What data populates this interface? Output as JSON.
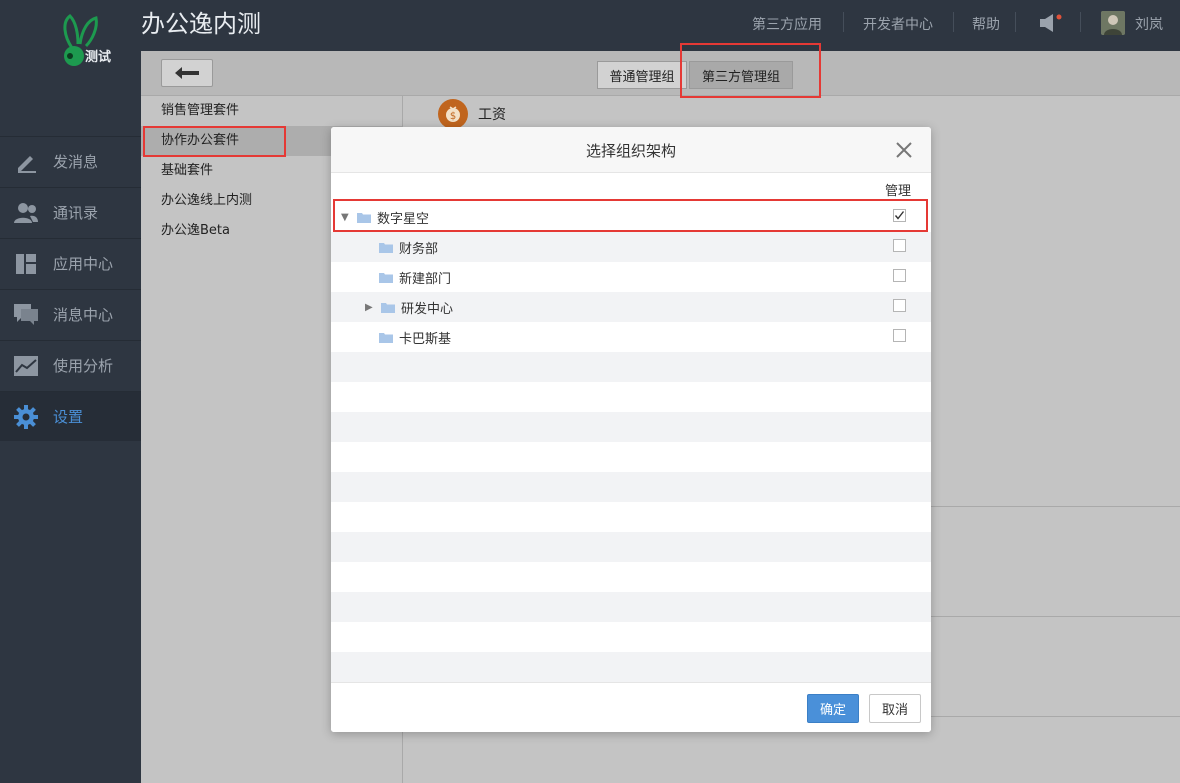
{
  "app": {
    "title": "办公逸内测",
    "logo_text": "测试"
  },
  "header": {
    "links": [
      "第三方应用",
      "开发者中心",
      "帮助"
    ],
    "user_name": "刘岚"
  },
  "sidebar": {
    "items": [
      {
        "label": "发消息",
        "icon": "pencil-icon"
      },
      {
        "label": "通讯录",
        "icon": "contacts-icon"
      },
      {
        "label": "应用中心",
        "icon": "apps-icon"
      },
      {
        "label": "消息中心",
        "icon": "messages-icon"
      },
      {
        "label": "使用分析",
        "icon": "chart-icon"
      },
      {
        "label": "设置",
        "icon": "gear-icon",
        "active": true
      }
    ]
  },
  "toolbar": {
    "tabs": [
      "普通管理组",
      "第三方管理组"
    ],
    "active_tab": "第三方管理组"
  },
  "suites": [
    "销售管理套件",
    "协作办公套件",
    "基础套件",
    "办公逸线上内测",
    "办公逸Beta"
  ],
  "selected_suite": "协作办公套件",
  "right_panel": {
    "app_name": "工资"
  },
  "modal": {
    "title": "选择组织架构",
    "column_manage": "管理",
    "tree": [
      {
        "name": "数字星空",
        "expanded": true,
        "checked": true
      },
      {
        "name": "财务部",
        "checked": false
      },
      {
        "name": "新建部门",
        "checked": false
      },
      {
        "name": "研发中心",
        "expanded": false,
        "checked": false
      },
      {
        "name": "卡巴斯基",
        "checked": false
      }
    ],
    "ok_label": "确定",
    "cancel_label": "取消"
  },
  "colors": {
    "accent": "#4a90d9",
    "highlight": "#e53935",
    "sidebar_bg": "#2e3641"
  }
}
